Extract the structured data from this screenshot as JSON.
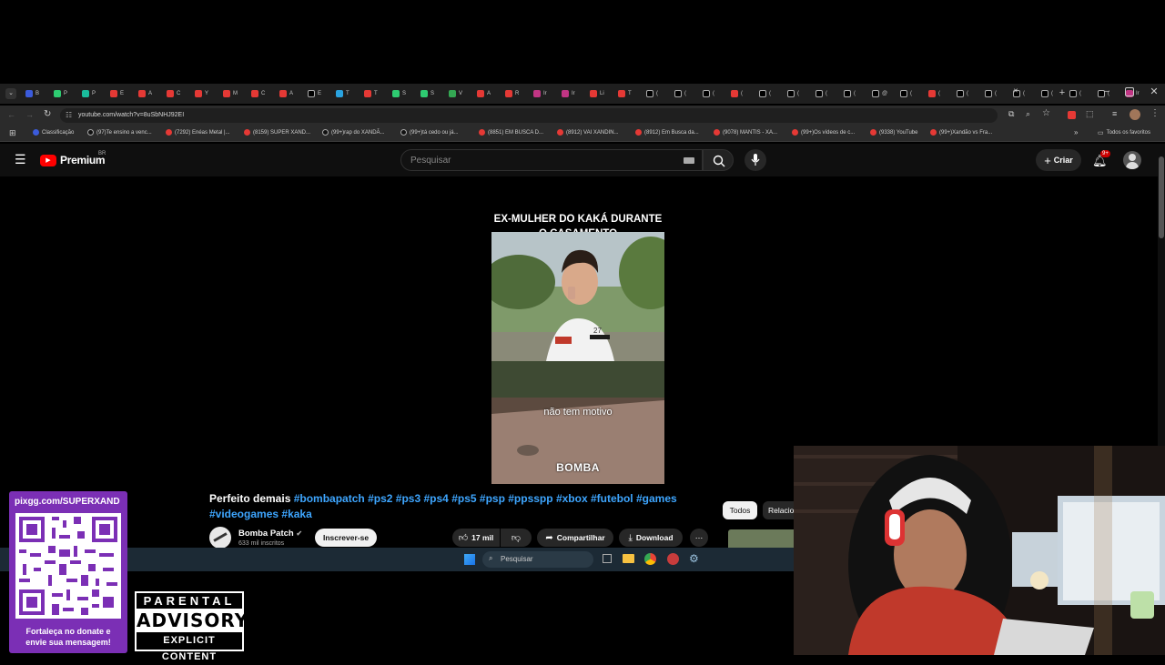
{
  "tabs": [
    "B",
    "P",
    "P",
    "E",
    "A",
    "C",
    "Y",
    "M",
    "C",
    "A",
    "E",
    "T",
    "T",
    "S",
    "S",
    "V",
    "A",
    "R",
    "Ir",
    "Ir",
    "Li",
    "T",
    "(",
    "(",
    "(",
    "(",
    "(",
    "(",
    "(",
    "(",
    "@",
    "(",
    "(",
    "(",
    "(",
    "(",
    "(",
    "(",
    "(",
    "Ir"
  ],
  "browser": {
    "url": "youtube.com/watch?v=8uSbNHJ92EI",
    "bookmarks": [
      "Classificação",
      "(97)Te ensino a venc...",
      "(7292) Enéas Metal |...",
      "(8159) SUPER XAND...",
      "(99+)rap do XANDÃ...",
      "(99+)tá cedo ou já...",
      "(8851) EM BUSCA D...",
      "(8912) VAI XANDIN...",
      "(8912) Em Busca da...",
      "(9078) MANTIS - XA...",
      "(99+)Os vídeos de c...",
      "(9338) YouTube",
      "(99+)Xandão vs Fra..."
    ],
    "all_favorites": "Todos os favoritos"
  },
  "youtube": {
    "logo": "Premium",
    "region": "BR",
    "search_placeholder": "Pesquisar",
    "create_label": "Criar",
    "notif_count": "9+"
  },
  "video": {
    "title_line1": "EX-MULHER DO KAKÁ DURANTE",
    "title_line2": "O CASAMENTO",
    "jersey_number": "27",
    "caption": "não tem motivo",
    "watermark": "BOMBA"
  },
  "description": {
    "text": "Perfeito demais",
    "hashtags": [
      "#bombapatch",
      "#ps2",
      "#ps3",
      "#ps4",
      "#ps5",
      "#psp",
      "#ppsspp",
      "#xbox",
      "#futebol",
      "#games",
      "#videogames",
      "#kaka"
    ]
  },
  "channel": {
    "name": "Bomba Patch",
    "subscribers": "633 mil inscritos",
    "subscribe_label": "Inscrever-se"
  },
  "actions": {
    "likes": "17 mil",
    "share": "Compartilhar",
    "download": "Download",
    "more": "⋯"
  },
  "filters": [
    "Todos",
    "Relacio"
  ],
  "taskbar": {
    "search_placeholder": "Pesquisar"
  },
  "overlay": {
    "qr_url": "pixgg.com/SUPERXAND",
    "qr_caption_line1": "Fortaleça no donate e",
    "qr_caption_line2": "envie sua mensagem!",
    "advisory_top": "PARENTAL",
    "advisory_mid": "ADVISORY",
    "advisory_bottom": "EXPLICIT CONTENT"
  },
  "colors": {
    "yt_red": "#ff0000",
    "link_blue": "#3ea6ff",
    "qr_purple": "#7b2fb5",
    "taskbar": "#1c2a35"
  }
}
